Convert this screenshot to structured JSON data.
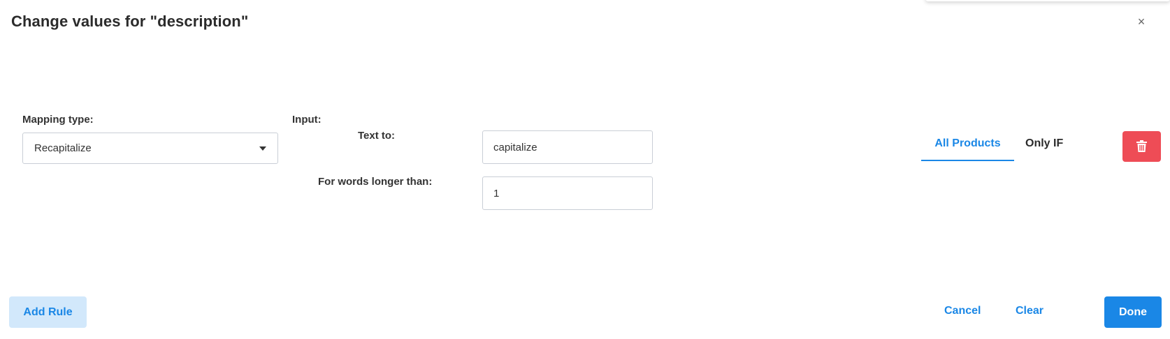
{
  "dialog": {
    "title": "Change values for \"description\"",
    "close_glyph": "×"
  },
  "mapping": {
    "label": "Mapping type:",
    "selected": "Recapitalize"
  },
  "input": {
    "label": "Input:",
    "text_to_label": "Text to:",
    "text_to_value": "capitalize",
    "words_longer_label": "For words longer than:",
    "words_longer_value": "1"
  },
  "scope_tabs": {
    "all_products": "All Products",
    "only_if": "Only IF",
    "active": "All Products"
  },
  "footer": {
    "add_rule": "Add Rule",
    "cancel": "Cancel",
    "clear": "Clear",
    "done": "Done"
  },
  "colors": {
    "accent": "#1a87e6",
    "danger": "#ee4c56",
    "add_rule_bg": "#d2e8fb"
  },
  "icons": {
    "close": "close-icon",
    "caret": "caret-down-icon",
    "delete": "trash-icon"
  }
}
